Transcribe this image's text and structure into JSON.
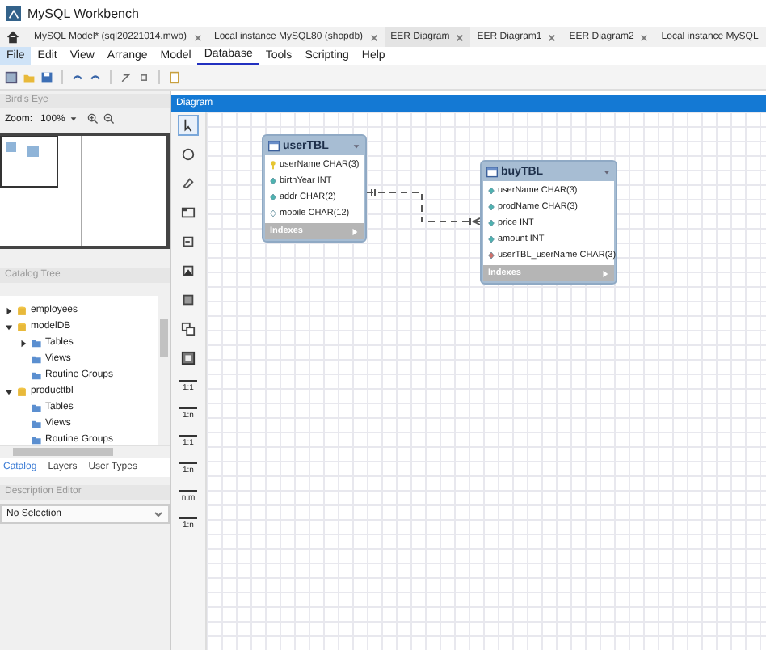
{
  "window": {
    "title": "MySQL Workbench"
  },
  "tabs": [
    {
      "label": "MySQL Model* (sql20221014.mwb)",
      "selected": false
    },
    {
      "label": "Local instance MySQL80 (shopdb)",
      "selected": false
    },
    {
      "label": "EER Diagram",
      "selected": true
    },
    {
      "label": "EER Diagram1",
      "selected": false
    },
    {
      "label": "EER Diagram2",
      "selected": false
    },
    {
      "label": "Local instance MySQL",
      "selected": false
    }
  ],
  "menu": [
    {
      "label": "File",
      "selected": true,
      "underlined": false
    },
    {
      "label": "Edit",
      "selected": false,
      "underlined": false
    },
    {
      "label": "View",
      "selected": false,
      "underlined": false
    },
    {
      "label": "Arrange",
      "selected": false,
      "underlined": false
    },
    {
      "label": "Model",
      "selected": false,
      "underlined": false
    },
    {
      "label": "Database",
      "selected": false,
      "underlined": true
    },
    {
      "label": "Tools",
      "selected": false,
      "underlined": false
    },
    {
      "label": "Scripting",
      "selected": false,
      "underlined": false
    },
    {
      "label": "Help",
      "selected": false,
      "underlined": false
    }
  ],
  "birds_eye": {
    "title": "Bird's Eye",
    "zoom_label": "Zoom:",
    "zoom_value": "100%"
  },
  "catalog": {
    "title": "Catalog Tree",
    "items": [
      {
        "label": "employees",
        "kind": "schema",
        "expanded": false
      },
      {
        "label": "modelDB",
        "kind": "schema",
        "expanded": true,
        "children": [
          {
            "label": "Tables",
            "kind": "folder",
            "expanded": false
          },
          {
            "label": "Views",
            "kind": "folder"
          },
          {
            "label": "Routine Groups",
            "kind": "folder"
          }
        ]
      },
      {
        "label": "producttbl",
        "kind": "schema",
        "expanded": true,
        "children": [
          {
            "label": "Tables",
            "kind": "folder"
          },
          {
            "label": "Views",
            "kind": "folder"
          },
          {
            "label": "Routine Groups",
            "kind": "folder"
          }
        ]
      }
    ]
  },
  "bottom_tabs": [
    {
      "label": "Catalog",
      "selected": true
    },
    {
      "label": "Layers",
      "selected": false
    },
    {
      "label": "User Types",
      "selected": false
    }
  ],
  "description_editor": {
    "title": "Description Editor",
    "value": "No Selection"
  },
  "diagram": {
    "title": "Diagram",
    "tools": [
      {
        "kind": "pointer",
        "selected": true
      },
      {
        "kind": "hand"
      },
      {
        "kind": "eraser"
      },
      {
        "kind": "layer"
      },
      {
        "kind": "note"
      },
      {
        "kind": "image"
      },
      {
        "kind": "table"
      },
      {
        "kind": "view"
      },
      {
        "kind": "routine"
      },
      {
        "kind": "relation",
        "label": "1:1"
      },
      {
        "kind": "relation",
        "label": "1:n"
      },
      {
        "kind": "relation",
        "label": "1:1"
      },
      {
        "kind": "relation",
        "label": "1:n"
      },
      {
        "kind": "relation",
        "label": "n:m"
      },
      {
        "kind": "relation",
        "label": "1:n"
      }
    ],
    "tables": [
      {
        "name": "userTBL",
        "columns": [
          {
            "name": "userName CHAR(3)",
            "kind": "primary"
          },
          {
            "name": "birthYear INT",
            "kind": "notnull"
          },
          {
            "name": "addr CHAR(2)",
            "kind": "notnull"
          },
          {
            "name": "mobile CHAR(12)",
            "kind": "nullable"
          }
        ],
        "footer": "Indexes"
      },
      {
        "name": "buyTBL",
        "columns": [
          {
            "name": "userName CHAR(3)",
            "kind": "notnull"
          },
          {
            "name": "prodName CHAR(3)",
            "kind": "notnull"
          },
          {
            "name": "price INT",
            "kind": "notnull"
          },
          {
            "name": "amount INT",
            "kind": "notnull"
          },
          {
            "name": "userTBL_userName CHAR(3)",
            "kind": "foreign"
          }
        ],
        "footer": "Indexes"
      }
    ]
  }
}
